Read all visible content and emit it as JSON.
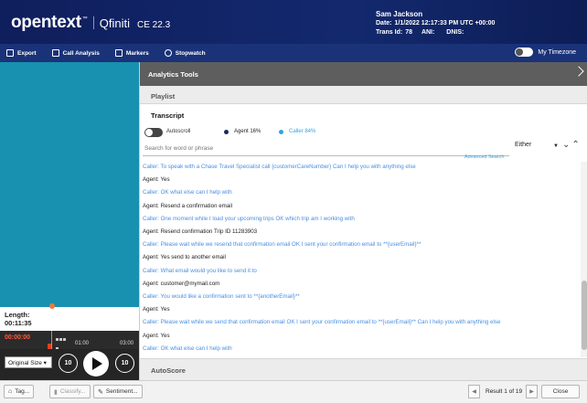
{
  "header": {
    "logo": "opentext",
    "product": "Qfiniti",
    "version": "CE 22.3",
    "user_name": "Sam Jackson",
    "date_label": "Date:",
    "date_value": "1/1/2022 12:17:33 PM UTC +00:00",
    "trans_label": "Trans Id:",
    "trans_value": "78",
    "ani_label": "ANI:",
    "dnis_label": "DNIS:"
  },
  "toolbar": {
    "export": "Export",
    "call_analysis": "Call Analysis",
    "markers": "Markers",
    "stopwatch": "Stopwatch",
    "my_timezone": "My Timezone"
  },
  "player": {
    "length_label": "Length:",
    "length_value": "00:11:35",
    "current_time": "00:00:00",
    "tick_1": "01:00",
    "tick_2": "03:00",
    "size_option": "Original Size",
    "skip_back": "10",
    "skip_forward": "10"
  },
  "panel": {
    "analytics_tools": "Analytics Tools",
    "playlist": "Playlist",
    "transcript": "Transcript",
    "autoscroll": "Autoscroll",
    "agent_pct": "Agent 16%",
    "caller_pct": "Caller 84%",
    "search_placeholder": "Search for word or phrase",
    "advanced_search": "Advanced Search",
    "either": "Either",
    "autoscore": "AutoScore"
  },
  "transcript_lines": [
    {
      "speaker": "caller",
      "text": "Caller: To speak with a Chase Travel Specialist call {customerCareNumber} Can I help you with anything else"
    },
    {
      "speaker": "agent",
      "text": "Agent: Yes"
    },
    {
      "speaker": "caller",
      "text": "Caller: OK what else can I help with"
    },
    {
      "speaker": "agent",
      "text": "Agent: Resend a confirmation email"
    },
    {
      "speaker": "caller",
      "text": "Caller: One moment while I load your upcoming trips OK which trip am I working with"
    },
    {
      "speaker": "agent",
      "text": "Agent: Resend confirmation Trip ID 11283903"
    },
    {
      "speaker": "caller",
      "text": "Caller: Please wait while we resend that confirmation email OK I sent your confirmation email to **{userEmail}**"
    },
    {
      "speaker": "agent",
      "text": "Agent: Yes send to another email"
    },
    {
      "speaker": "caller",
      "text": "Caller: What email would you like to send it to"
    },
    {
      "speaker": "agent",
      "text": "Agent: customer@mymail.com"
    },
    {
      "speaker": "caller",
      "text": "Caller: You would like a confirmation sent to **{anotherEmail}**"
    },
    {
      "speaker": "agent",
      "text": "Agent: Yes"
    },
    {
      "speaker": "caller",
      "text": "Caller: Please wait while we send that confirmation email OK I sent your confirmation email to **{userEmail}** Can I help you with anything else"
    },
    {
      "speaker": "agent",
      "text": "Agent: Yes"
    },
    {
      "speaker": "caller",
      "text": "Caller: OK what else can I help with"
    }
  ],
  "bottom": {
    "tag": "Tag...",
    "classify": "Classify...",
    "sentiment": "Sentiment...",
    "result": "Result 1 of 19",
    "close": "Close"
  },
  "colors": {
    "header_bg": "#0f1e5c",
    "toolbar_bg": "#1a3278",
    "video_bg": "#1891b0",
    "caller_text": "#4a8fe0",
    "agent_dot": "#1a2a5a"
  }
}
